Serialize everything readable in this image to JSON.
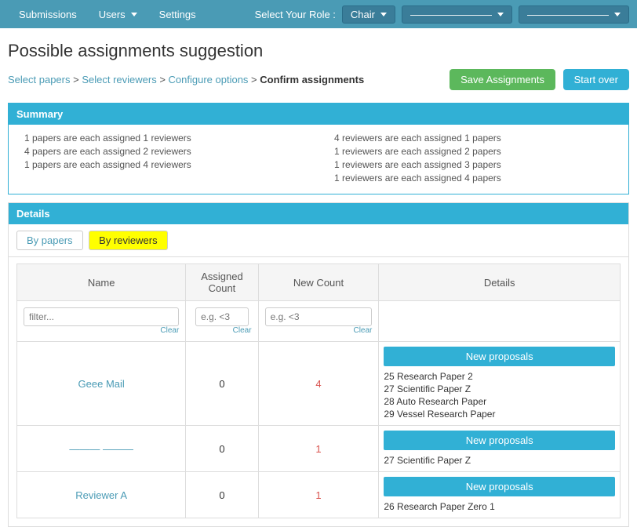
{
  "nav": {
    "links": [
      {
        "label": "Submissions",
        "id": "submissions"
      },
      {
        "label": "Users",
        "id": "users",
        "dropdown": true
      },
      {
        "label": "Settings",
        "id": "settings"
      }
    ],
    "role_label": "Select Your Role :",
    "role_value": "Chair",
    "dropdown1_placeholder": "————————",
    "dropdown2_placeholder": "————————"
  },
  "page": {
    "title": "Possible assignments suggestion",
    "breadcrumb": {
      "select_papers": "Select papers",
      "sep1": " > ",
      "select_reviewers": "Select reviewers",
      "sep2": " > ",
      "configure_options": "Configure options",
      "sep3": " > ",
      "confirm_assignments": "Confirm assignments"
    },
    "btn_save": "Save Assignments",
    "btn_start_over": "Start over"
  },
  "summary": {
    "header": "Summary",
    "left_items": [
      "1 papers are each assigned 1 reviewers",
      "4 papers are each assigned 2 reviewers",
      "1 papers are each assigned 4 reviewers"
    ],
    "right_items": [
      "4 reviewers are each assigned 1 papers",
      "1 reviewers are each assigned 2 papers",
      "1 reviewers are each assigned 3 papers",
      "1 reviewers are each assigned 4 papers"
    ]
  },
  "details": {
    "header": "Details",
    "tab_by_papers": "By papers",
    "tab_by_reviewers": "By reviewers",
    "active_tab": "by_reviewers",
    "table": {
      "col_name": "Name",
      "col_assigned": "Assigned Count",
      "col_new": "New Count",
      "col_details": "Details",
      "filter_name_placeholder": "filter...",
      "filter_assigned_placeholder": "e.g. <3",
      "filter_new_placeholder": "e.g. <3",
      "clear_label": "Clear",
      "rows": [
        {
          "name": "Geee Mail",
          "assigned": "0",
          "new_count": "4",
          "proposals_label": "New proposals",
          "proposals": [
            "25 Research Paper 2",
            "27 Scientific Paper Z",
            "28 Auto Research Paper",
            "29 Vessel Research Paper"
          ]
        },
        {
          "name": "——— ———",
          "assigned": "0",
          "new_count": "1",
          "proposals_label": "New proposals",
          "proposals": [
            "27 Scientific Paper Z"
          ]
        },
        {
          "name": "Reviewer A",
          "assigned": "0",
          "new_count": "1",
          "proposals_label": "New proposals",
          "proposals": [
            "26 Research Paper Zero 1"
          ]
        }
      ]
    }
  }
}
